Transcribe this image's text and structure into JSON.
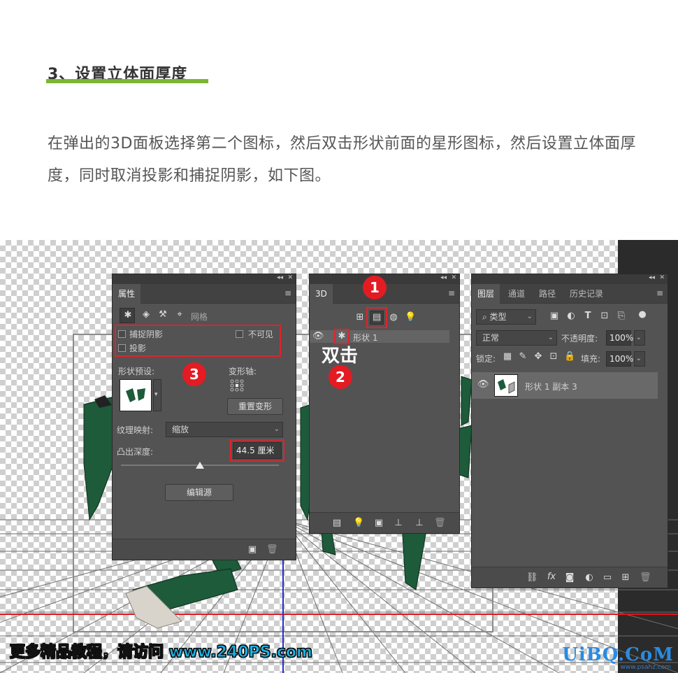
{
  "article": {
    "heading": "3、设置立体面厚度",
    "paragraph": "在弹出的3D面板选择第二个图标，然后双击形状前面的星形图标，然后设置立体面厚度，同时取消投影和捕捉阴影，如下图。"
  },
  "properties_panel": {
    "tab": "属性",
    "mode_label": "网格",
    "checkbox_capture_shadow": "捕捉阴影",
    "checkbox_invisible": "不可见",
    "checkbox_cast_shadow": "投影",
    "shape_preset_label": "形状预设:",
    "deform_axis_label": "变形轴:",
    "reset_deform_button": "重置变形",
    "texture_mapping_label": "纹理映射:",
    "texture_mapping_value": "缩放",
    "extrusion_depth_label": "凸出深度:",
    "extrusion_depth_value": "44.5 厘米",
    "edit_source_button": "编辑源",
    "extrusion_depth_fraction": 0.5
  },
  "threed_panel": {
    "tab": "3D",
    "layer_name": "形状 1"
  },
  "layers_panel": {
    "tabs": [
      "图层",
      "通道",
      "路径",
      "历史记录"
    ],
    "filter_label": "类型",
    "blend_mode": "正常",
    "opacity_label": "不透明度:",
    "opacity_value": "100%",
    "lock_label": "锁定:",
    "fill_label": "填充:",
    "fill_value": "100%",
    "layer_name": "形状 1 副本 3"
  },
  "annotations": {
    "badge1": "1",
    "badge2": "2",
    "badge3": "3",
    "double_click": "双击"
  },
  "watermarks": {
    "left_text": "更多精品教程，请访问",
    "left_url": "www.240PS.com",
    "right_text": "UiBQ.CoM",
    "right_sub": "www.psahz.com"
  },
  "colors": {
    "accent_green": "#7cb632",
    "badge_red": "#e31b23",
    "shape_green": "#1d5b3a",
    "panel_bg": "#535353"
  }
}
